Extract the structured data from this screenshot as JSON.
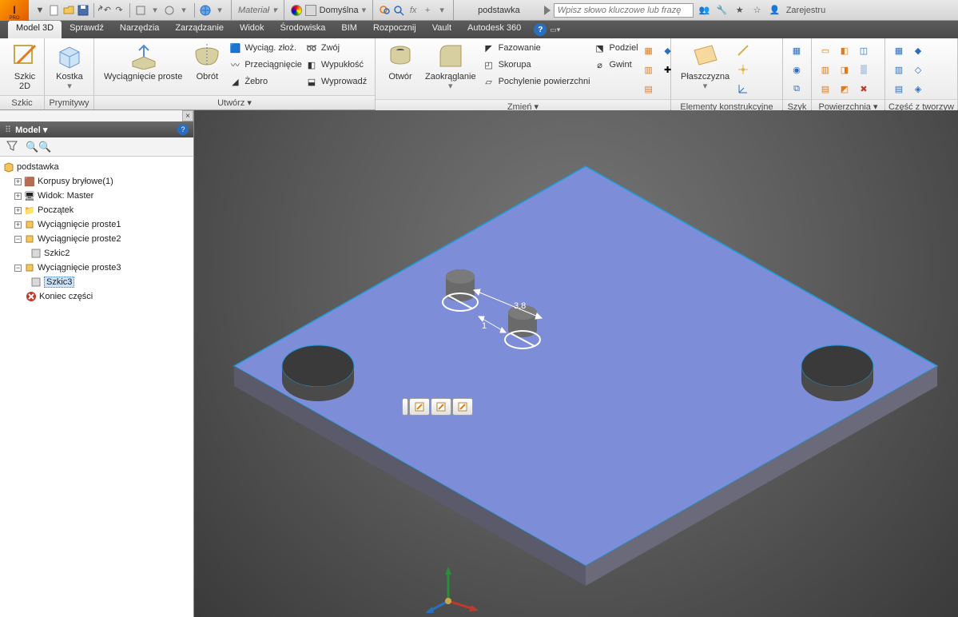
{
  "app": {
    "pro": "PRO"
  },
  "qat": {
    "material_label": "Materiał",
    "appearance_label": "Domyślna"
  },
  "doc": {
    "name": "podstawka"
  },
  "search": {
    "placeholder": "Wpisz słowo kluczowe lub frazę"
  },
  "account": {
    "label": "Zarejestru"
  },
  "menus": {
    "active": "Model 3D",
    "items": [
      "Sprawdź",
      "Narzędzia",
      "Zarządzanie",
      "Widok",
      "Środowiska",
      "BIM",
      "Rozpocznij",
      "Vault",
      "Autodesk 360"
    ]
  },
  "ribbon": {
    "panels": {
      "szkic": {
        "title": "Szkic",
        "btn": "Szkic\n2D"
      },
      "prym": {
        "title": "Prymitywy",
        "btn": "Kostka"
      },
      "utworz": {
        "title": "Utwórz ▾",
        "big1": "Wyciągnięcie proste",
        "big2": "Obrót",
        "rows": [
          "Wyciąg. złoż.",
          "Przeciągnięcie",
          "Żebro",
          "Zwój",
          "Wypukłość",
          "Wyprowadź"
        ]
      },
      "otwor": {
        "big1": "Otwór",
        "big2": "Zaokrąglanie"
      },
      "zmien": {
        "title": "Zmień ▾",
        "rows": [
          "Fazowanie",
          "Skorupa",
          "Pochylenie powierzchni",
          "Podziel",
          "Gwint"
        ]
      },
      "konstr": {
        "title": "Elementy konstrukcyjne",
        "btn": "Płaszczyzna"
      },
      "szyk": {
        "title": "Szyk"
      },
      "pow": {
        "title": "Powierzchnia ▾"
      },
      "tworz": {
        "title": "Część z tworzyw"
      }
    }
  },
  "browser": {
    "title": "Model ▾",
    "root": "podstawka",
    "items": [
      "Korpusy bryłowe(1)",
      "Widok: Master",
      "Początek",
      "Wyciągnięcie proste1",
      "Wyciągnięcie proste2",
      "Szkic2",
      "Wyciągnięcie proste3",
      "Szkic3",
      "Koniec części"
    ]
  },
  "dims": {
    "d1": "3,8",
    "d2": "1"
  }
}
